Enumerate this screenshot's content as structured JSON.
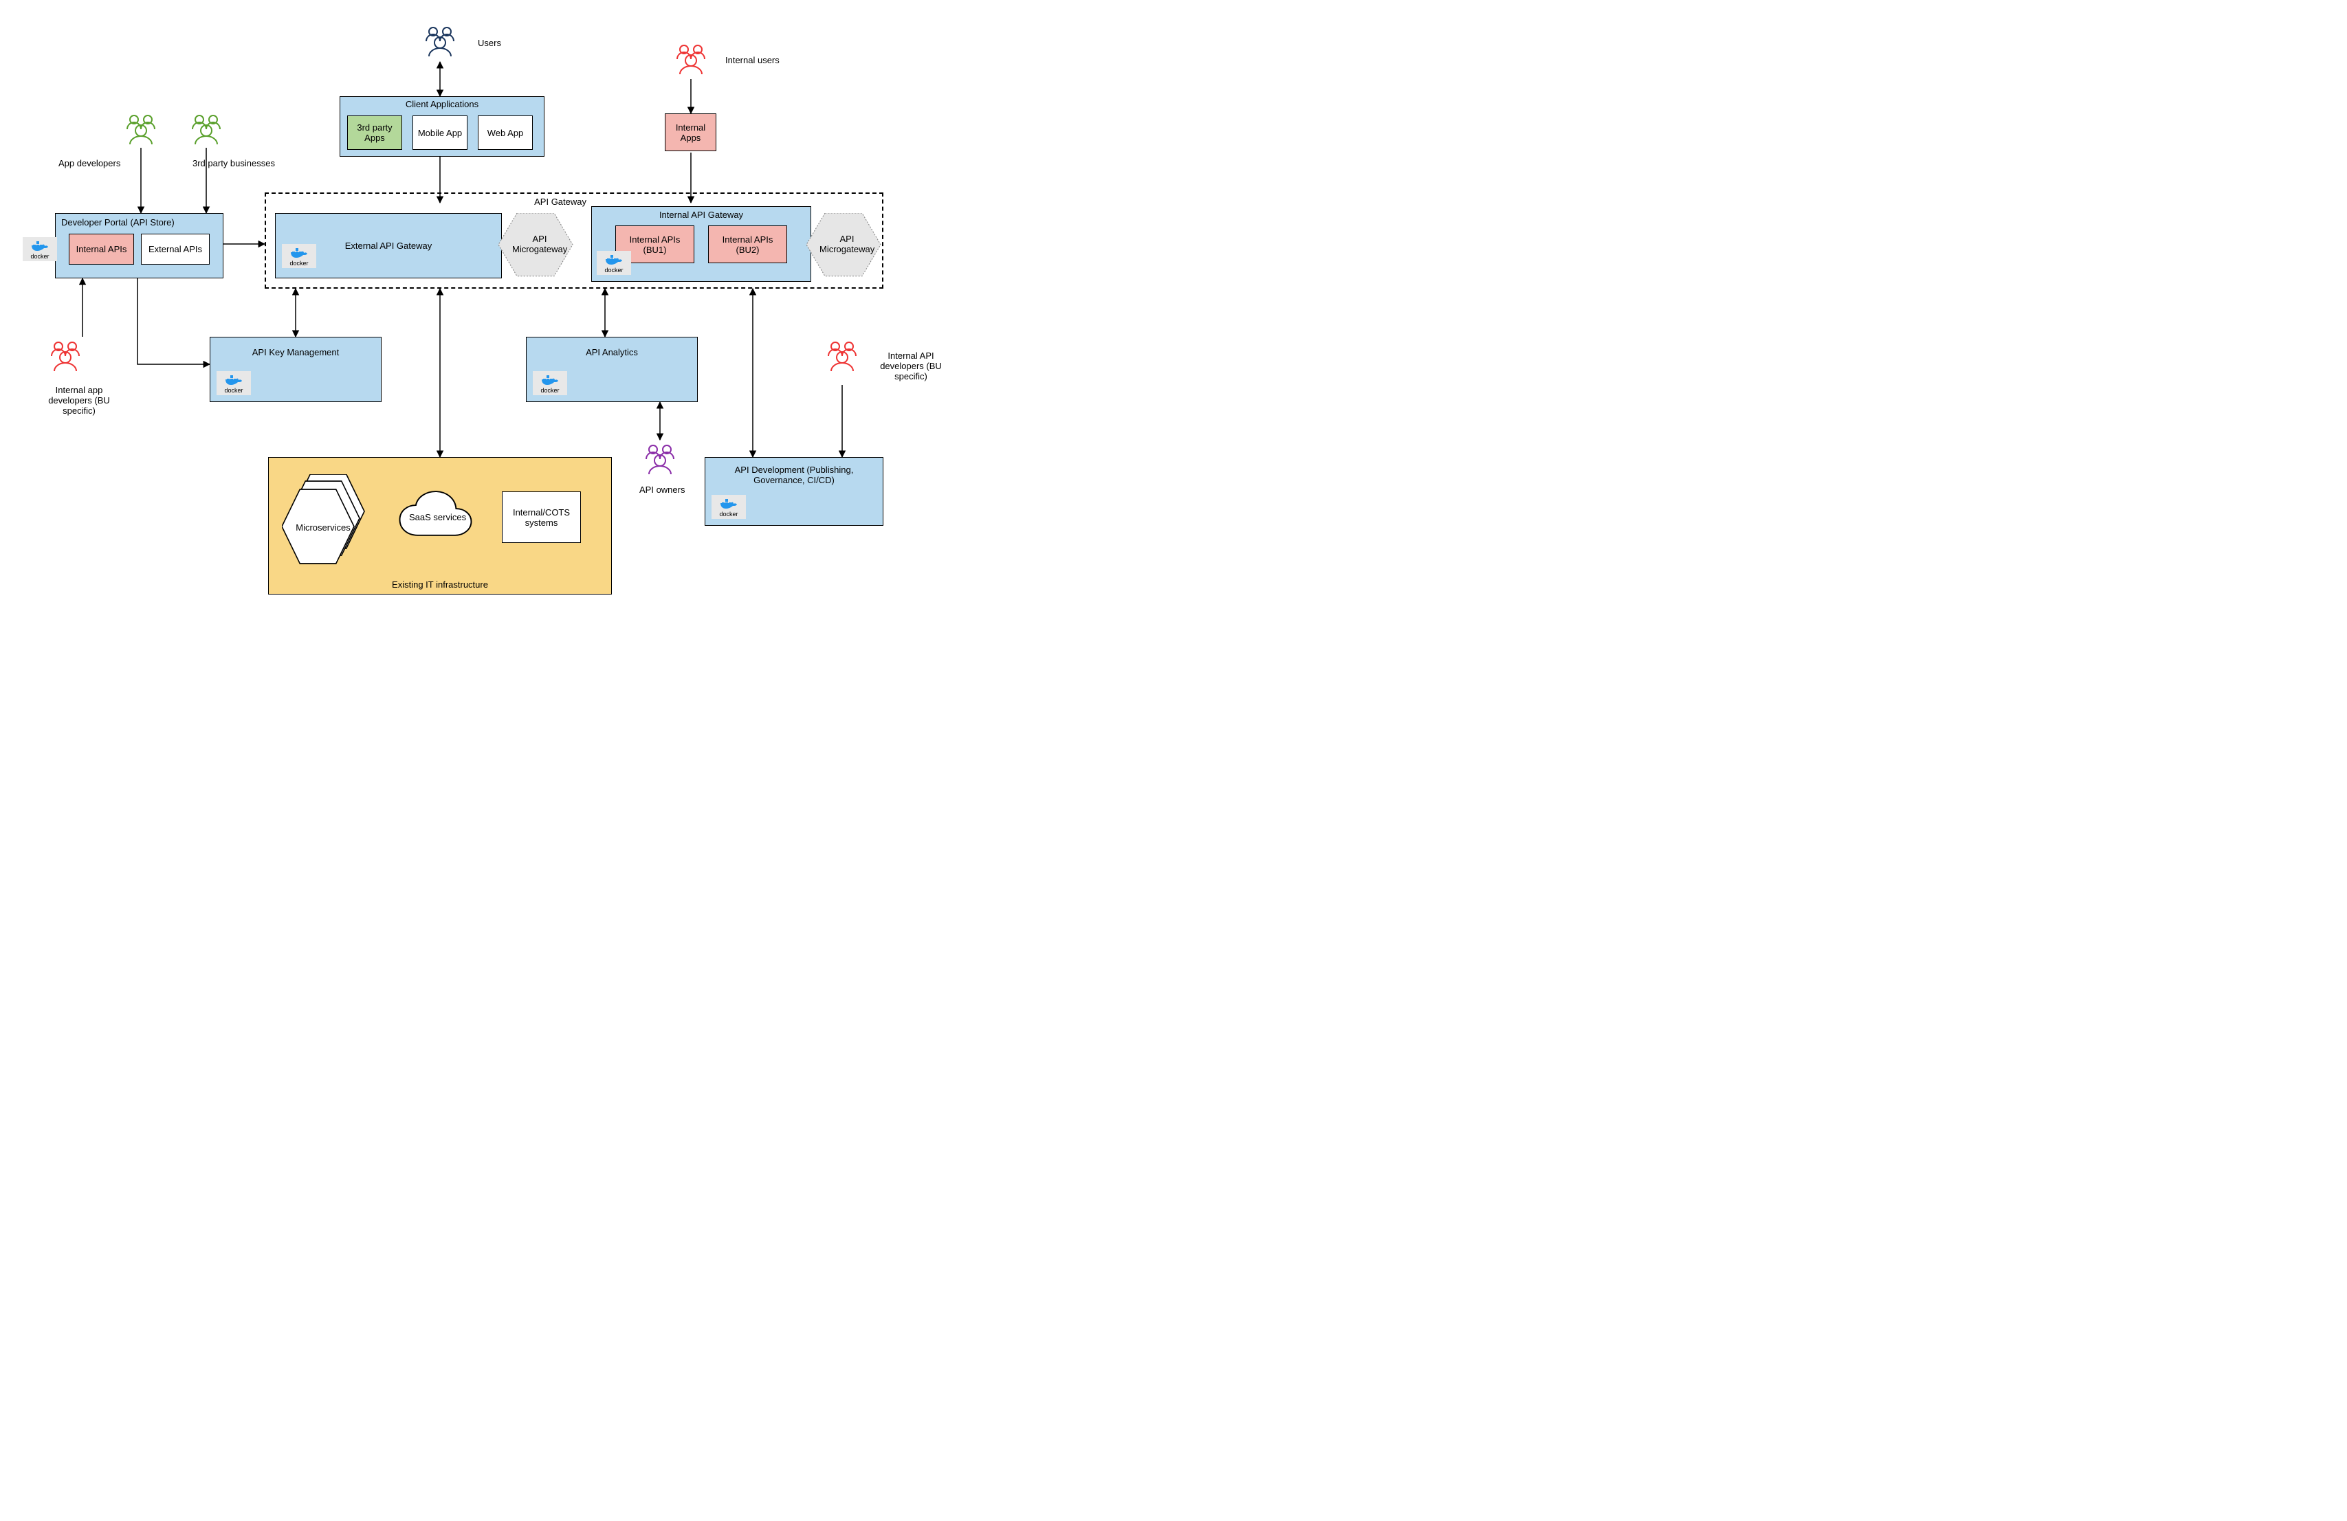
{
  "actors": {
    "users": "Users",
    "internalUsers": "Internal users",
    "appDevelopers": "App developers",
    "thirdPartyBusinesses": "3rd party businesses",
    "internalAppDevs": "Internal app\ndevelopers (BU\nspecific)",
    "internalApiDevs": "Internal API\ndevelopers (BU\nspecific)",
    "apiOwners": "API owners"
  },
  "clientApps": {
    "title": "Client Applications",
    "thirdParty": "3rd party\nApps",
    "mobile": "Mobile App",
    "web": "Web App"
  },
  "internalApps": "Internal\nApps",
  "devPortal": {
    "title": "Developer Portal (API Store)",
    "internal": "Internal APIs",
    "external": "External APIs"
  },
  "apiGateway": {
    "label": "API Gateway",
    "external": "External API Gateway",
    "internalTitle": "Internal API Gateway",
    "bu1": "Internal APIs\n(BU1)",
    "bu2": "Internal APIs\n(BU2)",
    "microgateway": "API\nMicrogateway"
  },
  "keyMgmt": "API Key Management",
  "analytics": "API Analytics",
  "apiDev": "API Development (Publishing,\nGovernance, CI/CD)",
  "infra": {
    "title": "Existing IT infrastructure",
    "microservices": "Microservices",
    "saas": "SaaS services",
    "cots": "Internal/COTS\nsystems"
  },
  "dockerLabel": "docker"
}
